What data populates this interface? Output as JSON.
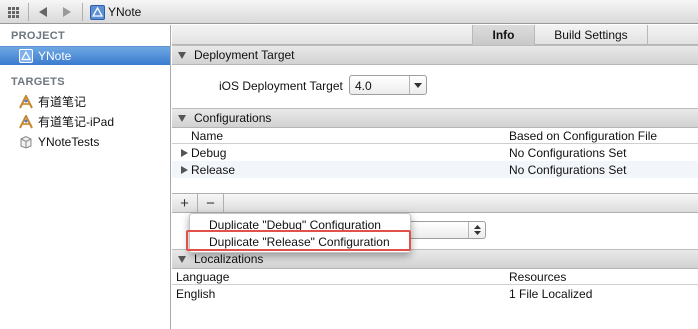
{
  "jumpbar": {
    "title": "YNote"
  },
  "sidebar": {
    "project_heading": "PROJECT",
    "project_item": "YNote",
    "targets_heading": "TARGETS",
    "targets": [
      "有道笔记",
      "有道笔记-iPad",
      "YNoteTests"
    ]
  },
  "tabs": {
    "info": "Info",
    "build_settings": "Build Settings"
  },
  "deployment": {
    "heading": "Deployment Target",
    "label": "iOS Deployment Target",
    "value": "4.0"
  },
  "configurations": {
    "heading": "Configurations",
    "columns": [
      "Name",
      "Based on Configuration File"
    ],
    "rows": [
      {
        "name": "Debug",
        "file": "No Configurations Set"
      },
      {
        "name": "Release",
        "file": "No Configurations Set"
      }
    ],
    "add": "+",
    "remove": "−"
  },
  "popup_menu": {
    "items": [
      "Duplicate \"Debug\" Configuration",
      "Duplicate \"Release\" Configuration"
    ]
  },
  "localizations": {
    "heading": "Localizations",
    "columns": [
      "Language",
      "Resources"
    ],
    "rows": [
      {
        "language": "English",
        "resources": "1 File Localized"
      }
    ]
  },
  "colors": {
    "selection": "#3a7bd0",
    "highlight_box": "#e2504a"
  },
  "icons": [
    "grid-icon",
    "back-arrow-icon",
    "forward-arrow-icon",
    "project-file-icon",
    "app-target-icon",
    "test-bundle-icon"
  ]
}
